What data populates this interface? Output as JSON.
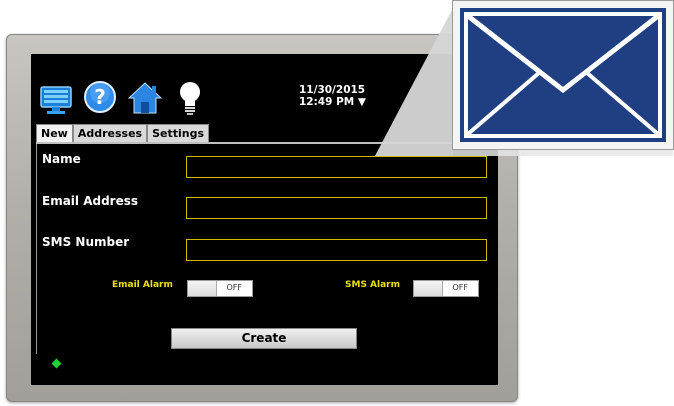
{
  "datetime": {
    "date": "11/30/2015",
    "time": "12:49 PM ▼"
  },
  "toolbar": {
    "icons": [
      "monitor-icon",
      "help-icon",
      "home-icon",
      "lightbulb-icon"
    ],
    "help_glyph": "?"
  },
  "tabs": [
    {
      "label": "New",
      "active": true
    },
    {
      "label": "Addresses",
      "active": false
    },
    {
      "label": "Settings",
      "active": false
    }
  ],
  "form": {
    "name_label": "Name",
    "name_value": "",
    "email_label": "Email Address",
    "email_value": "",
    "sms_label": "SMS Number",
    "sms_value": "",
    "email_alarm_label": "Email Alarm",
    "email_alarm_state": "OFF",
    "sms_alarm_label": "SMS Alarm",
    "sms_alarm_state": "OFF",
    "create_label": "Create"
  },
  "colors": {
    "screen_bg": "#000000",
    "field_border": "#cbbd00",
    "alarm_label": "#e8e000",
    "status_led": "#22d035",
    "envelope_blue": "#1f3f82"
  },
  "callout_icon": "envelope-icon"
}
